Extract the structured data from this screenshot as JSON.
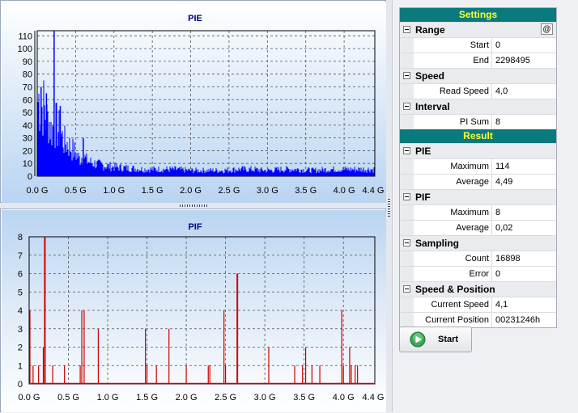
{
  "charts": {
    "pie": {
      "title": "PIE",
      "x_ticks": [
        "0.0 G",
        "0.5 G",
        "1.0 G",
        "1.5 G",
        "2.0 G",
        "2.5 G",
        "3.0 G",
        "3.5 G",
        "4.0 G",
        "4.4 G"
      ],
      "y_ticks": [
        "0",
        "10",
        "20",
        "30",
        "40",
        "50",
        "60",
        "70",
        "80",
        "90",
        "100",
        "110"
      ],
      "color": "#0000ff"
    },
    "pif": {
      "title": "PIF",
      "x_ticks": [
        "0.0 G",
        "0.5 G",
        "1.0 G",
        "1.5 G",
        "2.0 G",
        "2.5 G",
        "3.0 G",
        "3.5 G",
        "4.0 G",
        "4.4 G"
      ],
      "y_ticks": [
        "0",
        "1",
        "2",
        "3",
        "4",
        "5",
        "6",
        "7",
        "8"
      ],
      "color": "#cc0000"
    }
  },
  "chart_data": [
    {
      "type": "area",
      "title": "PIE",
      "xlim": [
        0,
        4.4
      ],
      "ylim": [
        0,
        114
      ],
      "x_unit": "G",
      "series": [
        {
          "x": [
            0.0,
            0.02,
            0.05,
            0.08,
            0.1,
            0.13,
            0.15,
            0.18,
            0.2,
            0.22,
            0.25,
            0.28,
            0.3,
            0.35,
            0.4,
            0.45,
            0.5,
            0.55,
            0.6,
            0.65,
            0.7,
            0.8,
            0.9,
            1.0,
            1.2,
            1.4,
            1.6,
            1.8,
            2.0,
            2.2,
            2.4,
            2.6,
            2.8,
            3.0,
            3.2,
            3.4,
            3.6,
            3.8,
            4.0,
            4.2,
            4.4
          ],
          "values": [
            62,
            68,
            58,
            62,
            55,
            48,
            50,
            40,
            42,
            45,
            44,
            40,
            38,
            30,
            28,
            24,
            20,
            15,
            18,
            13,
            12,
            10,
            9,
            8,
            7,
            6,
            6,
            6,
            5,
            5,
            5,
            6,
            6,
            5,
            6,
            6,
            5,
            6,
            6,
            6,
            6
          ],
          "peaks": [
            {
              "x": 0.22,
              "y": 114
            },
            {
              "x": 0.05,
              "y": 70
            },
            {
              "x": 0.12,
              "y": 65
            },
            {
              "x": 0.3,
              "y": 55
            },
            {
              "x": 0.6,
              "y": 30
            }
          ]
        }
      ]
    },
    {
      "type": "bar",
      "title": "PIF",
      "xlim": [
        0,
        4.4
      ],
      "ylim": [
        0,
        8
      ],
      "x_unit": "G",
      "series": [
        {
          "x": [
            0.01,
            0.05,
            0.12,
            0.18,
            0.2,
            0.3,
            0.45,
            0.65,
            0.67,
            0.7,
            0.88,
            1.48,
            1.5,
            1.62,
            1.78,
            2.0,
            2.28,
            2.3,
            2.48,
            2.5,
            2.65,
            3.05,
            3.38,
            3.48,
            3.52,
            3.6,
            3.7,
            3.98,
            4.0,
            4.08,
            4.1,
            4.15,
            4.18
          ],
          "values": [
            4,
            1,
            1,
            2,
            8,
            1,
            1,
            1,
            4,
            4,
            3,
            3,
            1,
            1,
            3,
            1,
            1,
            1,
            4,
            1,
            6,
            2,
            1,
            1,
            2,
            1,
            1,
            4,
            1,
            2,
            1,
            1,
            1
          ]
        }
      ]
    }
  ],
  "settings": {
    "header": "Settings",
    "range": {
      "label": "Range",
      "button": "@",
      "start_label": "Start",
      "start": "0",
      "end_label": "End",
      "end": "2298495"
    },
    "speed": {
      "label": "Speed",
      "read_label": "Read Speed",
      "read": "4,0"
    },
    "interval": {
      "label": "Interval",
      "pisum_label": "PI Sum",
      "pisum": "8"
    }
  },
  "result": {
    "header": "Result",
    "pie": {
      "label": "PIE",
      "max_label": "Maximum",
      "max": "114",
      "avg_label": "Average",
      "avg": "4,49"
    },
    "pif": {
      "label": "PIF",
      "max_label": "Maximum",
      "max": "8",
      "avg_label": "Average",
      "avg": "0,02"
    },
    "sampling": {
      "label": "Sampling",
      "count_label": "Count",
      "count": "16898",
      "error_label": "Error",
      "error": "0"
    },
    "speedpos": {
      "label": "Speed & Position",
      "cur_speed_label": "Current Speed",
      "cur_speed": "4,1",
      "cur_pos_label": "Current Position",
      "cur_pos": "00231246h"
    }
  },
  "start_button": {
    "label": "Start",
    "icon": "play-icon"
  }
}
